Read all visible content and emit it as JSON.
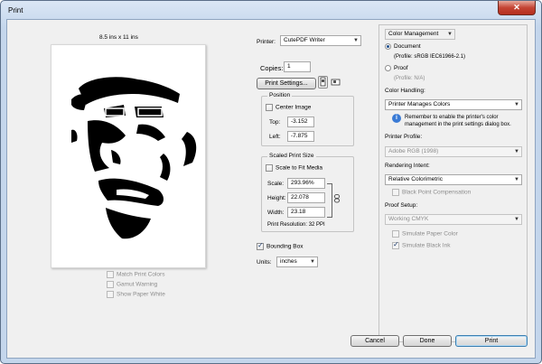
{
  "window": {
    "title": "Print",
    "close_label": "✕"
  },
  "preview": {
    "paper_size": "8.5 ins x 11 ins",
    "options": [
      {
        "label": "Match Print Colors",
        "checked": false,
        "enabled": false
      },
      {
        "label": "Gamut Warning",
        "checked": false,
        "enabled": false
      },
      {
        "label": "Show Paper White",
        "checked": false,
        "enabled": false
      }
    ]
  },
  "printer": {
    "label": "Printer:",
    "value": "CutePDF Writer",
    "copies_label": "Copies:",
    "copies_value": "1",
    "settings_button": "Print Settings..."
  },
  "position": {
    "title": "Position",
    "center_image": "Center Image",
    "top_label": "Top:",
    "top_value": "-3.152",
    "left_label": "Left:",
    "left_value": "-7.875"
  },
  "scaled": {
    "title": "Scaled Print Size",
    "scale_to_fit": "Scale to Fit Media",
    "scale_label": "Scale:",
    "scale_value": "293.96%",
    "height_label": "Height:",
    "height_value": "22.078",
    "width_label": "Width:",
    "width_value": "23.18",
    "resolution": "Print Resolution: 32 PPI"
  },
  "bounding_box": {
    "label": "Bounding Box",
    "checked": true
  },
  "units": {
    "label": "Units:",
    "value": "inches"
  },
  "color": {
    "section": "Color Management",
    "document_label": "Document",
    "document_profile": "(Profile: sRGB IEC61966-2.1)",
    "proof_label": "Proof",
    "proof_profile": "(Profile: N/A)",
    "handling_label": "Color Handling:",
    "handling_value": "Printer Manages Colors",
    "notice": "Remember to enable the printer's color management in the print settings dialog box.",
    "printer_profile_label": "Printer Profile:",
    "printer_profile_value": "Adobe RGB (1998)",
    "intent_label": "Rendering Intent:",
    "intent_value": "Relative Colorimetric",
    "black_point": "Black Point Compensation",
    "proof_setup_label": "Proof Setup:",
    "proof_setup_value": "Working CMYK",
    "simulate_paper": "Simulate Paper Color",
    "simulate_black": "Simulate Black Ink"
  },
  "buttons": {
    "cancel": "Cancel",
    "done": "Done",
    "print": "Print"
  },
  "colors": {
    "accent": "#3a7bd5",
    "window_frame": "#c4d6ec"
  }
}
